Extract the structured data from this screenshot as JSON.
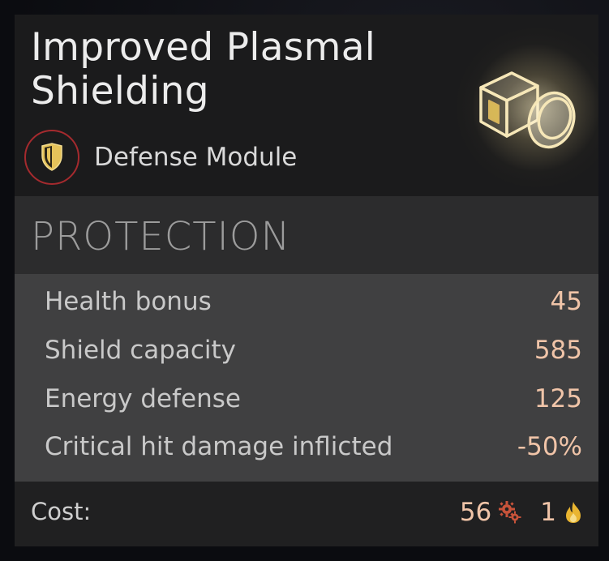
{
  "item": {
    "title_line1": "Improved Plasmal",
    "title_line2": "Shielding",
    "type_label": "Defense Module",
    "type_icon": "shield-icon",
    "module_icon": "module-cube-icon"
  },
  "section": {
    "title": "PROTECTION"
  },
  "stats": [
    {
      "label": "Health bonus",
      "value": "45"
    },
    {
      "label": "Shield capacity",
      "value": "585"
    },
    {
      "label": "Energy defense",
      "value": "125"
    },
    {
      "label": "Critical hit damage inflicted",
      "value": "-50%"
    }
  ],
  "cost": {
    "label": "Cost:",
    "industry_value": "56",
    "industry_icon": "gears-icon",
    "influence_value": "1",
    "influence_icon": "flame-icon"
  },
  "colors": {
    "value_accent": "#f0c4a8",
    "badge_ring": "#a52a2e",
    "icon_gold": "#e6c35a"
  }
}
